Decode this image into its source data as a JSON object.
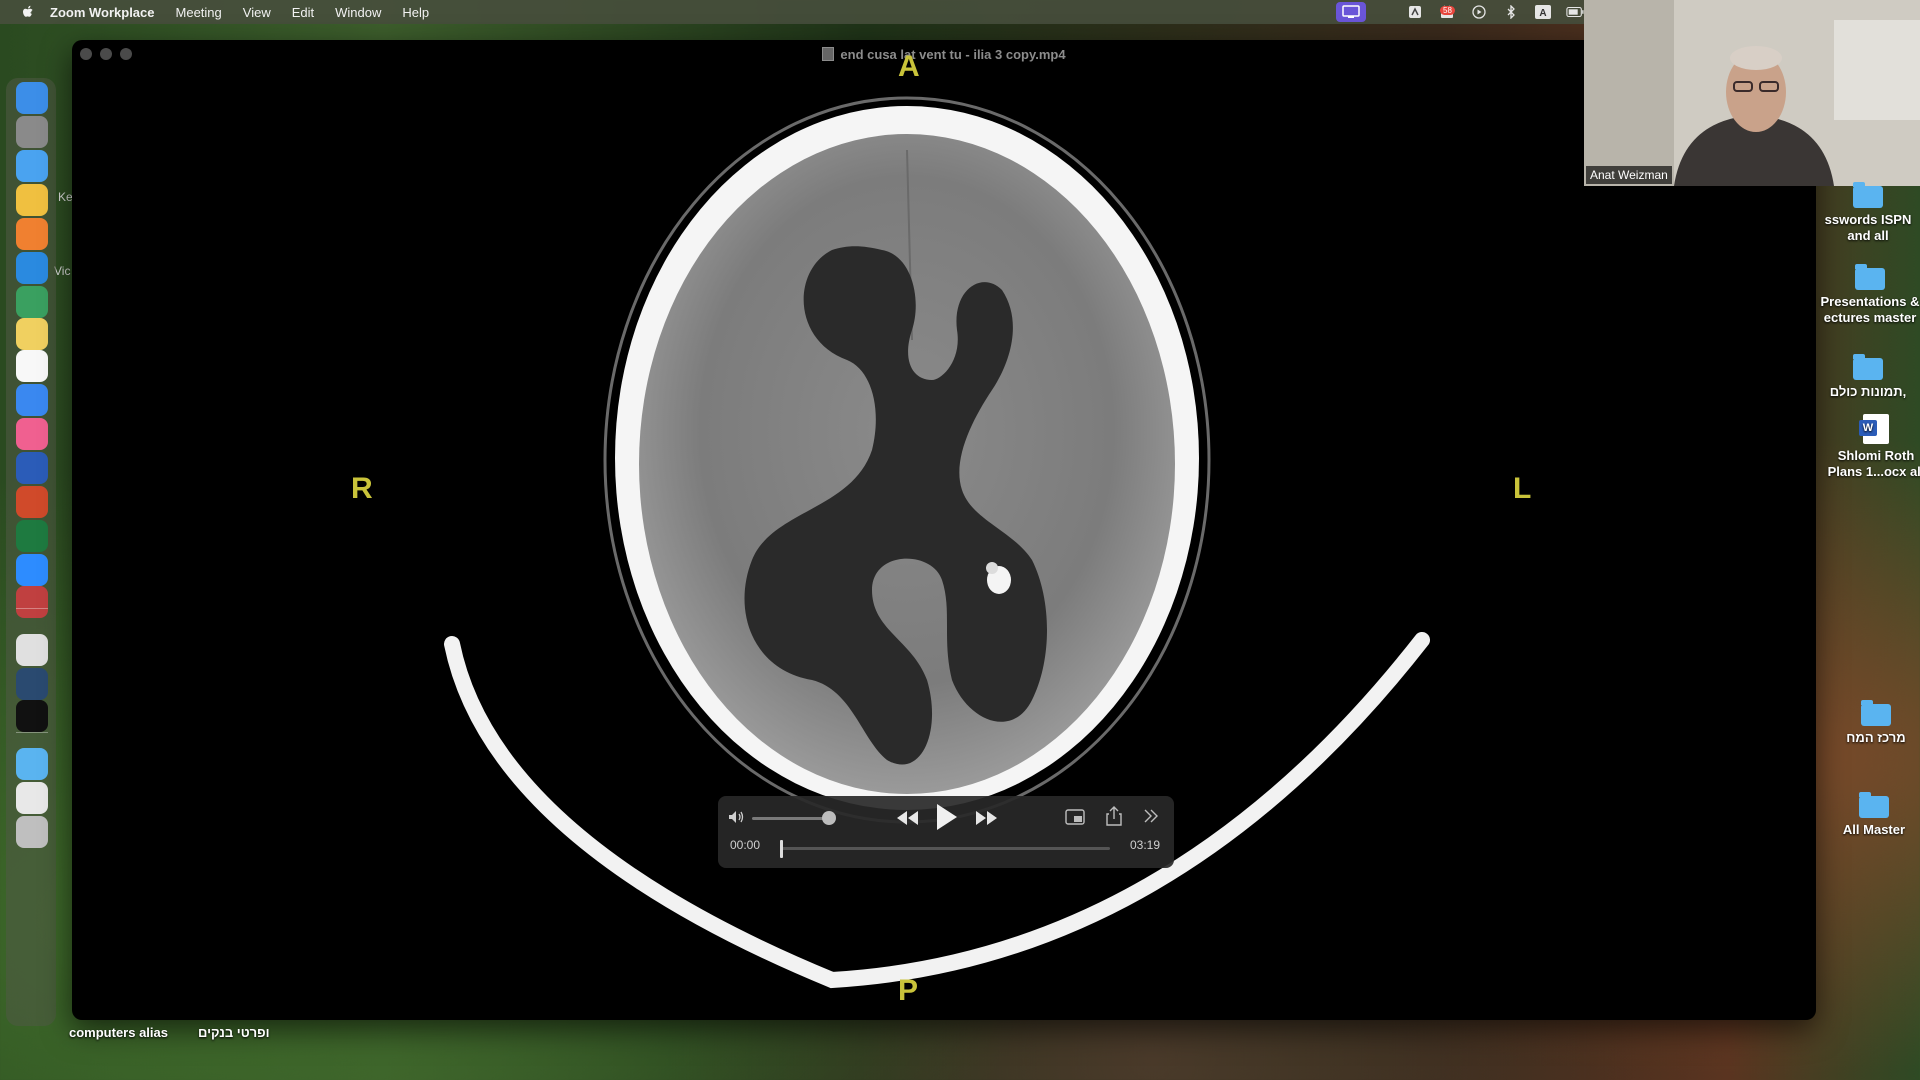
{
  "menubar": {
    "app_name": "Zoom Workplace",
    "items": [
      "Meeting",
      "View",
      "Edit",
      "Window",
      "Help"
    ],
    "badge_count": "58"
  },
  "window": {
    "title": "end cusa lat vent tu - ilia 3 copy.mp4"
  },
  "scan_labels": {
    "top": "A",
    "bottom": "P",
    "left": "R",
    "right": "L"
  },
  "player": {
    "current_time": "00:00",
    "duration": "03:19",
    "progress": 0,
    "volume": 0.85
  },
  "webcam": {
    "participant_name": "Anat Weizman"
  },
  "desktop_icons": [
    {
      "label_line1": "sswords ISPN",
      "label_line2": "and  all",
      "type": "folder"
    },
    {
      "label_line1": "Presentations &",
      "label_line2": "ectures master",
      "type": "folder"
    },
    {
      "label_line1": "תמונות כולם,",
      "label_line2": "",
      "type": "folder"
    },
    {
      "label_line1": "Shlomi Roth",
      "label_line2": "Plans 1...ocx ali",
      "type": "word"
    },
    {
      "label_line1": "מרכז המח",
      "label_line2": "",
      "type": "folder"
    },
    {
      "label_line1": "All Master",
      "label_line2": "",
      "type": "folder"
    }
  ],
  "bottom_labels": [
    "computers alias",
    "ופרטי בנקים"
  ],
  "left_peek": [
    "Ke",
    "Vic"
  ],
  "dock_apps": [
    "finder-icon",
    "system-settings-icon",
    "mail-icon",
    "chrome-icon",
    "firefox-icon",
    "app-icon",
    "app-icon",
    "notes-icon",
    "stickies-icon",
    "safari-icon",
    "photos-icon",
    "word-icon",
    "powerpoint-icon",
    "excel-icon",
    "zoom-icon",
    "app-icon",
    "preview-icon",
    "quicktime-icon",
    "apple-tv-icon",
    "downloads-folder-icon",
    "documents-icon",
    "trash-icon"
  ],
  "colors": {
    "scan_label": "#c9c33a",
    "zoom_active": "#6a55d8",
    "folder": "#5ab4f0"
  }
}
